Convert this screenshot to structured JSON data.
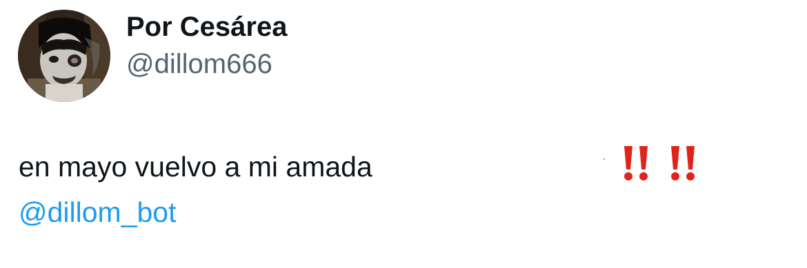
{
  "tweet": {
    "author": {
      "display_name": "Por Cesárea",
      "handle": "@dillom666",
      "avatar_icon": "profile-photo-avatar"
    },
    "text": "en mayo vuelvo a mi amada",
    "mention": "@dillom_bot",
    "emojis": [
      "double-exclamation-mark-icon",
      "double-exclamation-mark-icon"
    ],
    "colors": {
      "text": "#0f1419",
      "handle": "#536471",
      "mention": "#1d9bf0",
      "emoji": "#e0241b"
    }
  }
}
